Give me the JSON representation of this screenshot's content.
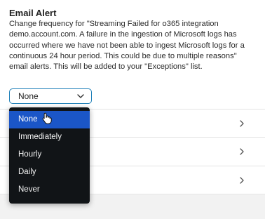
{
  "alert": {
    "title": "Email Alert",
    "description": "Change frequency for \"Streaming Failed for o365 integration demo.account.com. A failure in the ingestion of Microsoft logs has occurred where we have not been able to ingest Microsoft logs for a continuous 24 hour period. This could be due to multiple reasons\" email alerts. This will be added to your \"Exceptions\" list."
  },
  "frequency_select": {
    "value": "None",
    "options": [
      "None",
      "Immediately",
      "Hourly",
      "Daily",
      "Never"
    ]
  },
  "icons": {
    "select_chevron": "chevron-down-icon",
    "row_chevron": "chevron-right-icon",
    "cursor": "hand-pointer-icon"
  },
  "colors": {
    "accent_border": "#1d7fb8",
    "menu_background": "#111417",
    "menu_selected": "#1b56c7"
  }
}
